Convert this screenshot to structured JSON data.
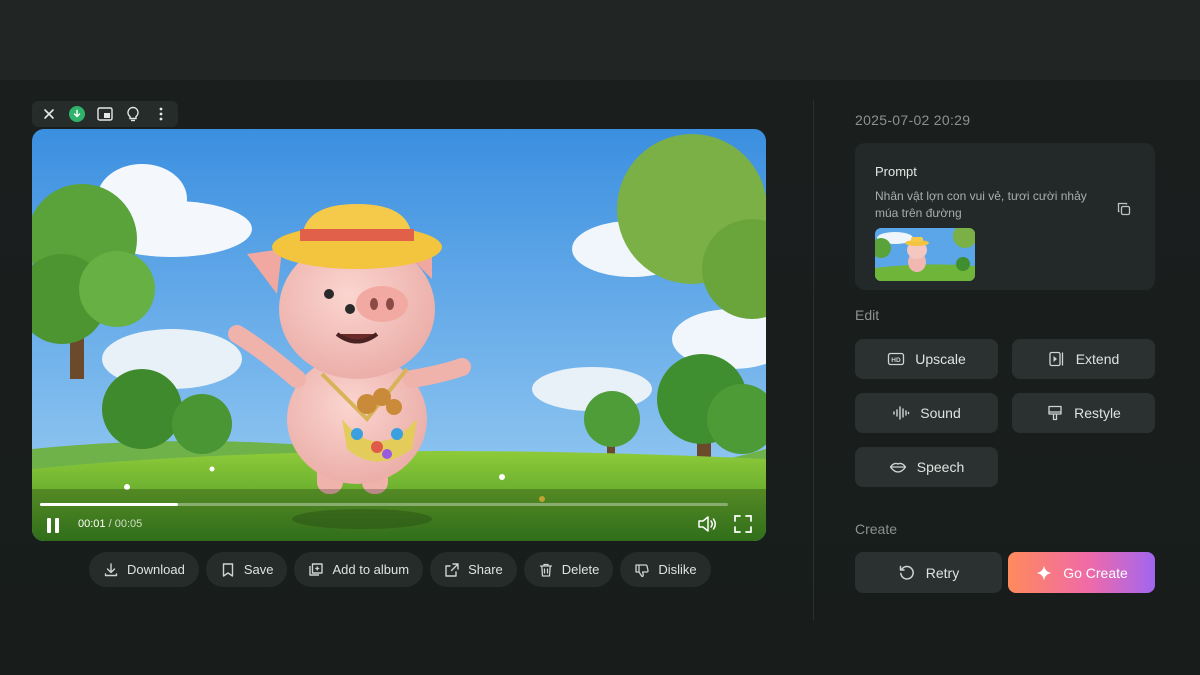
{
  "toolbar": {
    "icons": [
      "close-icon",
      "download-icon",
      "picture-in-picture-icon",
      "lightbulb-icon",
      "more-vertical-icon"
    ]
  },
  "player": {
    "current_time": "00:01",
    "separator": " / ",
    "duration": "00:05",
    "progress": 0.2,
    "state": "playing"
  },
  "actions": [
    {
      "label": "Download",
      "icon": "download-icon"
    },
    {
      "label": "Save",
      "icon": "bookmark-icon"
    },
    {
      "label": "Add to album",
      "icon": "album-add-icon"
    },
    {
      "label": "Share",
      "icon": "share-icon"
    },
    {
      "label": "Delete",
      "icon": "trash-icon"
    },
    {
      "label": "Dislike",
      "icon": "thumbs-down-icon"
    }
  ],
  "details": {
    "date": "2025-07-02 20:29",
    "prompt_title": "Prompt",
    "prompt_text": "Nhân vật lợn con vui vẻ, tươi cười nhảy múa trên đường"
  },
  "edit": {
    "label": "Edit",
    "tools": [
      {
        "label": "Upscale",
        "icon": "hd-icon"
      },
      {
        "label": "Extend",
        "icon": "extend-icon"
      },
      {
        "label": "Sound",
        "icon": "waveform-icon"
      },
      {
        "label": "Restyle",
        "icon": "brush-icon"
      },
      {
        "label": "Speech",
        "icon": "lips-icon"
      }
    ]
  },
  "create": {
    "label": "Create",
    "retry_label": "Retry",
    "go_create_label": "Go Create"
  },
  "colors": {
    "background": "#1b201f",
    "panel": "#2b3130",
    "accent_gradient": [
      "#ff8a5c",
      "#f06aa8",
      "#a066f0"
    ],
    "download_green": "#2fb36a"
  }
}
